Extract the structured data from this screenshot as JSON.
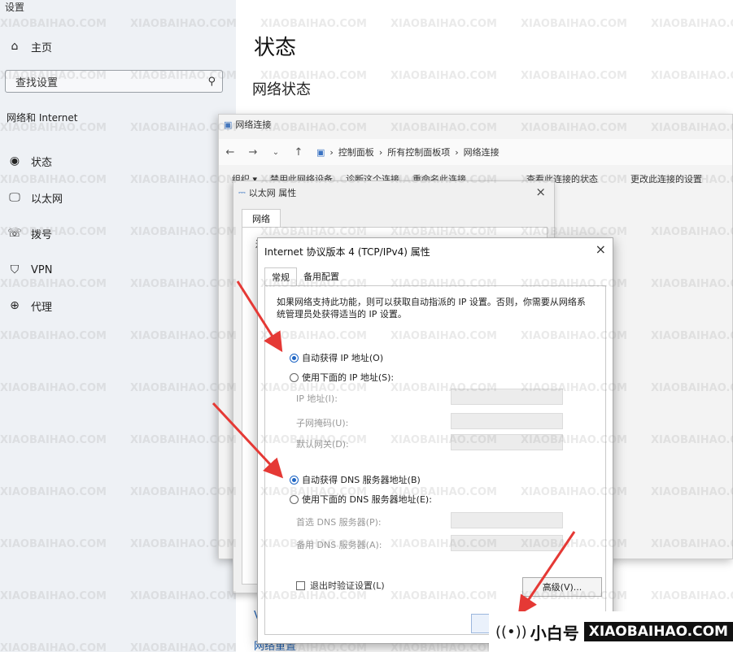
{
  "settings": {
    "app_title": "设置",
    "nav_home": "主页",
    "search_placeholder": "查找设置",
    "section_label": "网络和 Internet",
    "nav_items": [
      {
        "label": "状态",
        "icon": "globe-icon"
      },
      {
        "label": "以太网",
        "icon": "monitor-icon"
      },
      {
        "label": "拨号",
        "icon": "phone-icon"
      },
      {
        "label": "VPN",
        "icon": "shield-icon"
      },
      {
        "label": "代理",
        "icon": "globe-icon"
      }
    ],
    "page_title": "状态",
    "sub_title": "网络状态",
    "link_v": "V",
    "link_reset": "网络重置"
  },
  "net_window": {
    "title": "网络连接",
    "breadcrumbs": [
      "控制面板",
      "所有控制面板项",
      "网络连接"
    ],
    "commands": [
      "组织 ▾",
      "禁用此网络设备",
      "诊断这个连接",
      "重命名此连接",
      "查看此连接的状态",
      "更改此连接的设置"
    ]
  },
  "eth_window": {
    "title": "以太网 属性",
    "tab": "网络",
    "label_partial": "连"
  },
  "ipv4_dialog": {
    "title": "Internet 协议版本 4 (TCP/IPv4) 属性",
    "tabs": [
      "常规",
      "备用配置"
    ],
    "description": "如果网络支持此功能，则可以获取自动指派的 IP 设置。否则，你需要从网络系统管理员处获得适当的 IP 设置。",
    "radio_auto_ip": "自动获得 IP 地址(O)",
    "radio_manual_ip": "使用下面的 IP 地址(S):",
    "field_ip": "IP 地址(I):",
    "field_mask": "子网掩码(U):",
    "field_gateway": "默认网关(D):",
    "radio_auto_dns": "自动获得 DNS 服务器地址(B)",
    "radio_manual_dns": "使用下面的 DNS 服务器地址(E):",
    "field_dns1": "首选 DNS 服务器(P):",
    "field_dns2": "备用 DNS 服务器(A):",
    "checkbox_validate": "退出时验证设置(L)",
    "advanced_button": "高级(V)..."
  },
  "brand": {
    "cn": "小白号",
    "en": "XIAOBAIHAO.COM"
  },
  "colors": {
    "accent": "#1f66c4",
    "arrow": "#e53935"
  }
}
